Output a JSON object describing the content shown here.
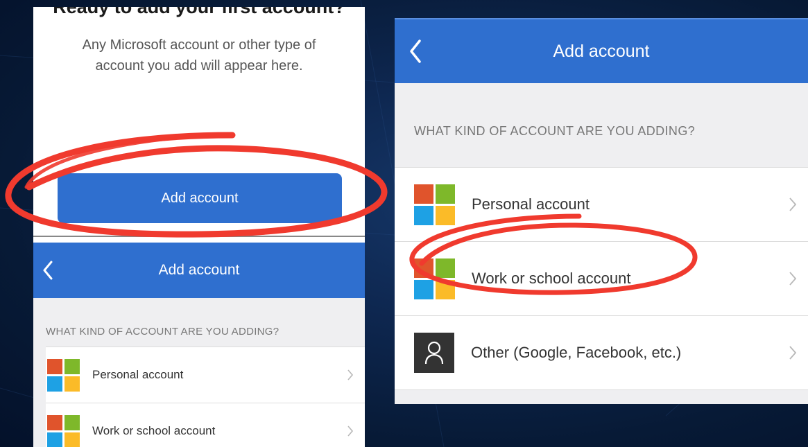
{
  "colors": {
    "brand_blue": "#2f6fcf",
    "annotation_red": "#f03a2e",
    "background_navy": "#0e2750",
    "list_background": "#efeff1"
  },
  "left_panel": {
    "heading": "Ready to add your first account?",
    "description": "Any Microsoft account or other type of account you add will appear here.",
    "add_button_label": "Add account",
    "header_title": "Add account",
    "back_icon": "chevron-left-icon",
    "section_label": "WHAT KIND OF ACCOUNT ARE YOU ADDING?",
    "items": [
      {
        "label": "Personal account",
        "icon": "microsoft-logo-icon"
      },
      {
        "label": "Work or school account",
        "icon": "microsoft-logo-icon"
      }
    ]
  },
  "right_panel": {
    "header_title": "Add account",
    "back_icon": "chevron-left-icon",
    "section_label": "WHAT KIND OF ACCOUNT ARE YOU ADDING?",
    "items": [
      {
        "label": "Personal account",
        "icon": "microsoft-logo-icon"
      },
      {
        "label": "Work or school account",
        "icon": "microsoft-logo-icon"
      },
      {
        "label": "Other (Google, Facebook, etc.)",
        "icon": "person-icon"
      }
    ]
  },
  "annotations": [
    {
      "target": "left-add-account-button",
      "shape": "hand-drawn-ellipse"
    },
    {
      "target": "right-work-or-school-account",
      "shape": "hand-drawn-ellipse"
    }
  ]
}
